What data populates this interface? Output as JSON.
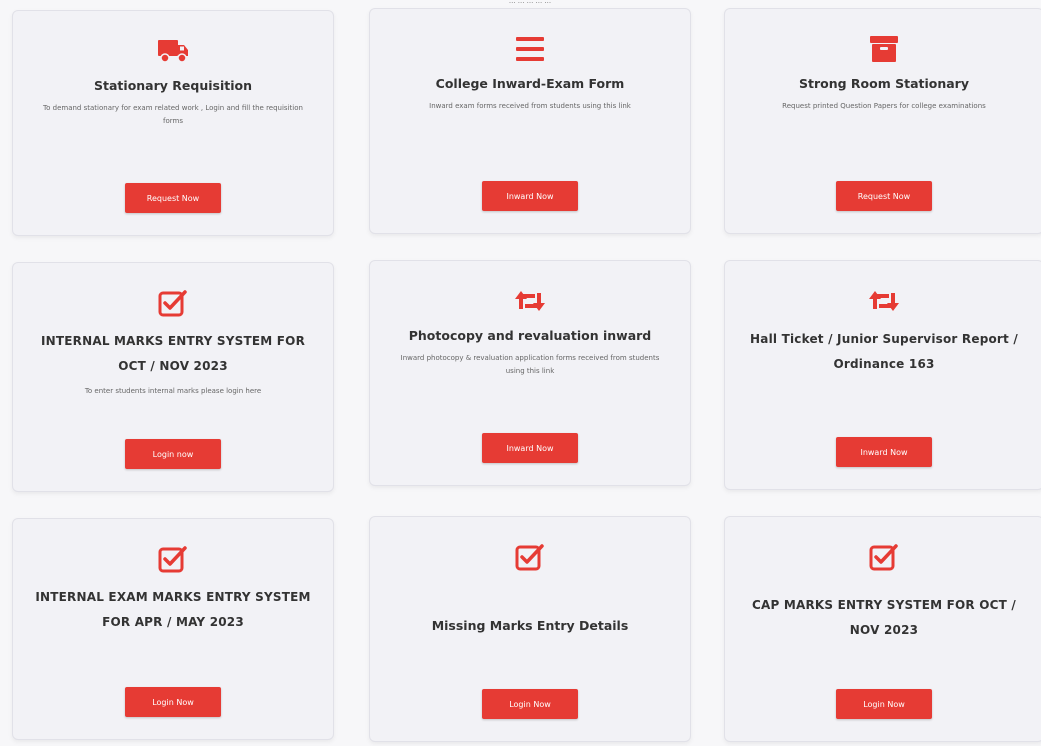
{
  "header": {
    "caption": "... ... ... ... ..."
  },
  "colors": {
    "accent": "#e63b34",
    "card_bg": "#f2f2f6",
    "page_bg": "#f7f7f9"
  },
  "cards": [
    {
      "icon": "truck-icon",
      "title": "Stationary Requisition",
      "description": "To demand stationary for exam related work , Login and fill the requisition forms",
      "button": "Request Now"
    },
    {
      "icon": "list-icon",
      "title": "College Inward-Exam Form",
      "description": "Inward exam forms received from students using this link",
      "button": "Inward Now"
    },
    {
      "icon": "box-icon",
      "title": "Strong Room Stationary",
      "description": "Request printed Question Papers for college examinations",
      "button": "Request Now"
    },
    {
      "icon": "checkbox-icon",
      "title": "INTERNAL MARKS ENTRY SYSTEM FOR OCT / NOV 2023",
      "description": "To enter students internal marks please login here",
      "button": "Login now"
    },
    {
      "icon": "retweet-icon",
      "title": "Photocopy and revaluation inward",
      "description": "Inward photocopy & revaluation application forms received from students using this link",
      "button": "Inward Now"
    },
    {
      "icon": "retweet-icon",
      "title": "Hall Ticket / Junior Supervisor Report / Ordinance 163",
      "description": "",
      "button": "Inward Now"
    },
    {
      "icon": "checkbox-icon",
      "title": "INTERNAL EXAM MARKS ENTRY SYSTEM FOR APR / MAY 2023",
      "description": "",
      "button": "Login Now"
    },
    {
      "icon": "checkbox-icon",
      "title": "Missing Marks Entry Details",
      "description": "",
      "button": "Login Now"
    },
    {
      "icon": "checkbox-icon",
      "title": "CAP MARKS ENTRY SYSTEM FOR OCT / NOV 2023",
      "description": "",
      "button": "Login Now"
    }
  ]
}
